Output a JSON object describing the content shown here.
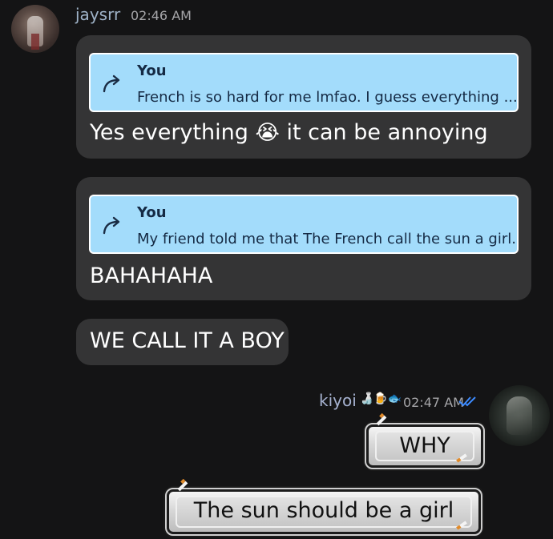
{
  "messages": {
    "first_sender": {
      "username": "jaysrr",
      "timestamp": "02:46 AM",
      "username_color": "#9fb3c8",
      "bubbles": [
        {
          "reply": {
            "author": "You",
            "text": "French is so hard for me lmfao. I guess everything ..."
          },
          "text_before_emoji": "Yes everything",
          "emoji": "😭",
          "text_after_emoji": "it can be annoying"
        },
        {
          "reply": {
            "author": "You",
            "text": "My friend told me that The French call the sun a girl."
          },
          "text": "BAHAHAHA"
        },
        {
          "text": "WE CALL IT A BOY"
        }
      ]
    },
    "second_sender": {
      "username": "kiyoi",
      "badge_emojis": "🍶🍺🐟",
      "timestamp": "02:47 AM",
      "read_status_icon": "double-check-icon",
      "username_color": "#a6b2d0",
      "bubbles": [
        {
          "text": "WHY"
        },
        {
          "text": "The sun should be a girl"
        }
      ]
    }
  },
  "colors": {
    "background": "#141415",
    "bubble": "#343435",
    "reply_bg": "#a3dcfb",
    "reply_text": "#152a44",
    "read_check": "#3d8bff"
  }
}
